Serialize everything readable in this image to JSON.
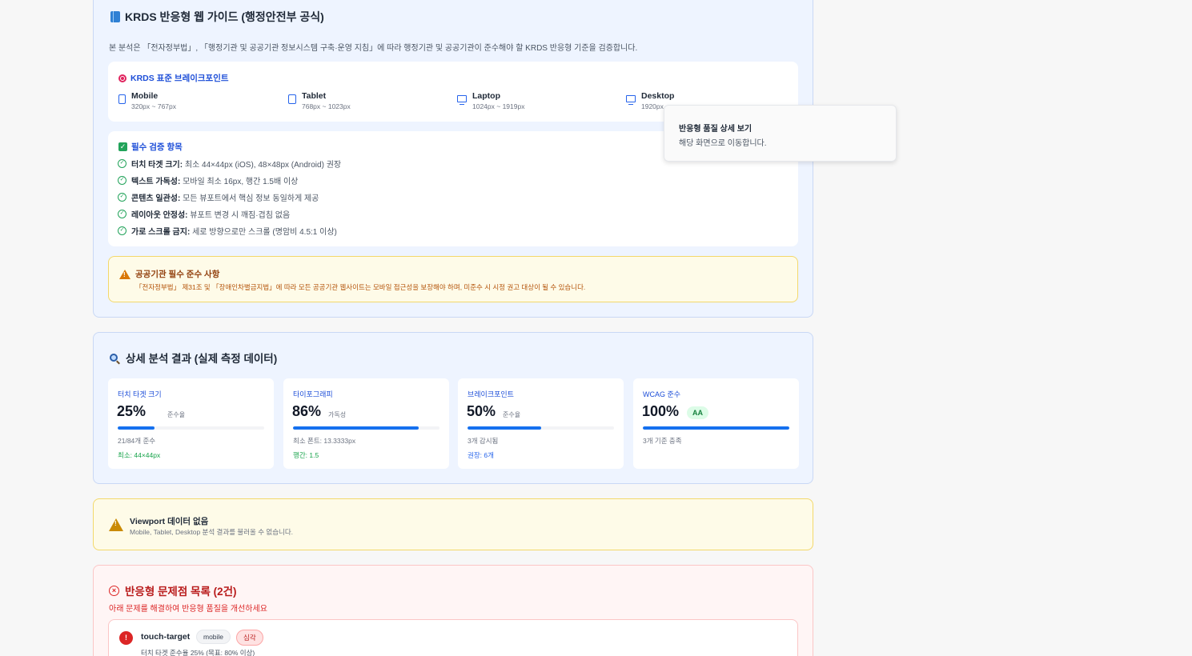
{
  "guide": {
    "title": "KRDS 반응형 웹 가이드 (행정안전부 공식)",
    "description": "본 분석은 「전자정부법」, 「행정기관 및 공공기관 정보시스템 구축·운영 지침」에 따라 행정기관 및 공공기관이 준수해야 할 KRDS 반응형 기준을 검증합니다.",
    "breakpoints_title": "KRDS 표준 브레이크포인트",
    "breakpoints": [
      {
        "name": "Mobile",
        "range": "320px ~ 767px",
        "icon": "mobile-icon"
      },
      {
        "name": "Tablet",
        "range": "768px ~ 1023px",
        "icon": "tablet-icon"
      },
      {
        "name": "Laptop",
        "range": "1024px ~ 1919px",
        "icon": "laptop-icon"
      },
      {
        "name": "Desktop",
        "range": "1920px ~",
        "icon": "desktop-icon"
      }
    ],
    "checks_title": "필수 검증 항목",
    "checks": [
      {
        "label": "터치 타겟 크기:",
        "text": "최소 44×44px (iOS), 48×48px (Android) 권장"
      },
      {
        "label": "텍스트 가독성:",
        "text": "모바일 최소 16px, 행간 1.5배 이상"
      },
      {
        "label": "콘텐츠 일관성:",
        "text": "모든 뷰포트에서 핵심 정보 동일하게 제공"
      },
      {
        "label": "레이아웃 안정성:",
        "text": "뷰포트 변경 시 깨짐·겹침 없음"
      },
      {
        "label": "가로 스크롤 금지:",
        "text": "세로 방향으로만 스크롤 (명암비 4.5:1 이상)"
      }
    ],
    "warning_title": "공공기관 필수 준수 사항",
    "warning_text": "「전자정부법」 제31조 및 「장애인차별금지법」에 따라 모든 공공기관 웹사이트는 모바일 접근성을 보장해야 하며, 미준수 시 시정 권고 대상이 될 수 있습니다."
  },
  "tooltip": {
    "title": "반응형 품질 상세 보기",
    "description": "해당 화면으로 이동합니다."
  },
  "analysis": {
    "title": "상세 분석 결과 (실제 측정 데이터)",
    "metrics": [
      {
        "label": "터치 타겟 크기",
        "value": "25%",
        "unit": "준수율",
        "progress": 0.25,
        "sub": "21/84개 준수",
        "note": "최소: 44×44px",
        "note_color": "#16a34a"
      },
      {
        "label": "타이포그래피",
        "value": "86%",
        "unit": "가독성",
        "progress": 0.86,
        "sub": "최소 폰트: 13.3333px",
        "note": "행간: 1.5",
        "note_color": "#16a34a"
      },
      {
        "label": "브레이크포인트",
        "value": "50%",
        "unit": "준수율",
        "progress": 0.5,
        "sub": "3개 감시됨",
        "note": "권장: 6개",
        "note_color": "#2563eb"
      },
      {
        "label": "WCAG 준수",
        "value": "100%",
        "badge": "AA",
        "progress": 1.0,
        "sub": "3개 기준 충족"
      }
    ]
  },
  "viewport": {
    "title": "Viewport 데이터 없음",
    "description": "Mobile, Tablet, Desktop 분석 결과를 불러올 수 없습니다."
  },
  "issues": {
    "title": "반응형 문제점 목록 (2건)",
    "subtitle": "아래 문제를 해결하여 반응형 품질을 개선하세요",
    "items": [
      {
        "name": "touch-target",
        "device": "mobile",
        "severity": "심각",
        "description": "터치 타겟 준수율 25% (목표: 80% 이상)"
      }
    ]
  }
}
